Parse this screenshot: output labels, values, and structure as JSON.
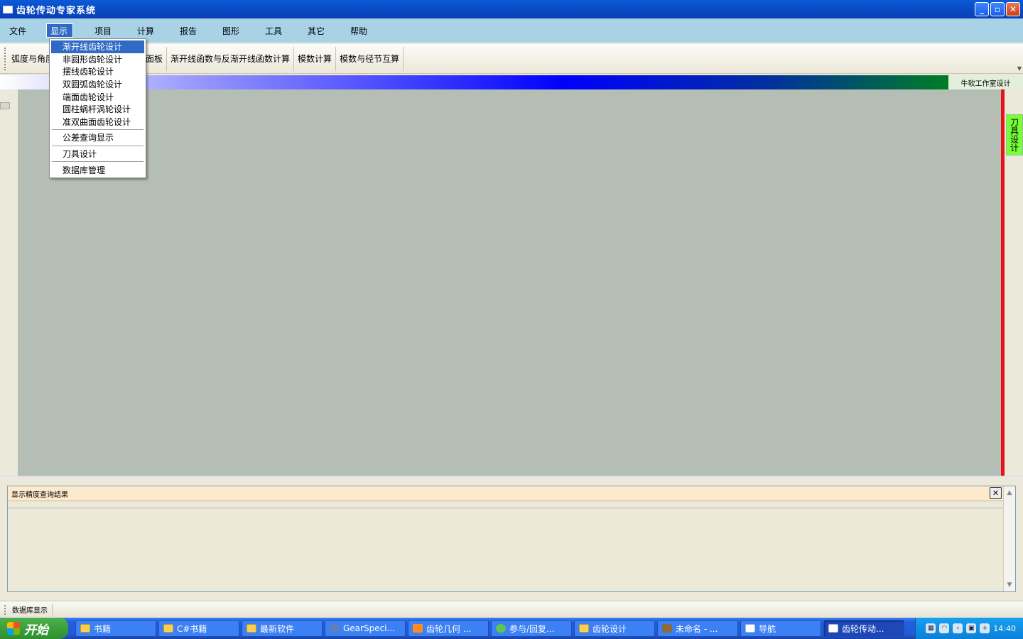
{
  "window": {
    "title": "齿轮传动专家系统",
    "controls": [
      "_",
      "▫",
      "✕"
    ]
  },
  "menubar": {
    "items": [
      "文件",
      "显示",
      "项目",
      "计算",
      "报告",
      "图形",
      "工具",
      "其它",
      "帮助"
    ],
    "active": "显示"
  },
  "toolbar": {
    "buttons": [
      "弧度与角度",
      "面板",
      "显示面板",
      "渐开线函数与反渐开线函数计算",
      "模数计算",
      "模数与径节互算"
    ]
  },
  "dropdown": {
    "group1": [
      "渐开线齿轮设计",
      "非圆形齿轮设计",
      "摆线齿轮设计",
      "双圆弧齿轮设计",
      "端面齿轮设计",
      "圆柱蜗杆涡轮设计",
      "准双曲面齿轮设计"
    ],
    "group2": "公差查询显示",
    "group3": "刀具设计",
    "group4": "数据库管理"
  },
  "band": {
    "label": "牛软工作室设计"
  },
  "side_tab": {
    "label": "刀具设计"
  },
  "results_panel": {
    "title": "显示精度查询结果",
    "close": "✕"
  },
  "statusbar": {
    "label": "数据库显示"
  },
  "taskbar": {
    "start": "开始",
    "tasks": [
      {
        "label": "书籍",
        "icon": "folder-icon"
      },
      {
        "label": "C#书籍",
        "icon": "folder-icon"
      },
      {
        "label": "最新软件",
        "icon": "folder-icon"
      },
      {
        "label": "GearSpeci...",
        "icon": "gear-app-icon"
      },
      {
        "label": "齿轮几何 ...",
        "icon": "browser-icon"
      },
      {
        "label": "参与/回复...",
        "icon": "chat-icon"
      },
      {
        "label": "齿轮设计",
        "icon": "folder-icon"
      },
      {
        "label": "未命名 - ...",
        "icon": "paint-icon"
      },
      {
        "label": "导航",
        "icon": "window-icon"
      },
      {
        "label": "齿轮传动...",
        "icon": "window-icon"
      }
    ],
    "clock": "14:40"
  }
}
